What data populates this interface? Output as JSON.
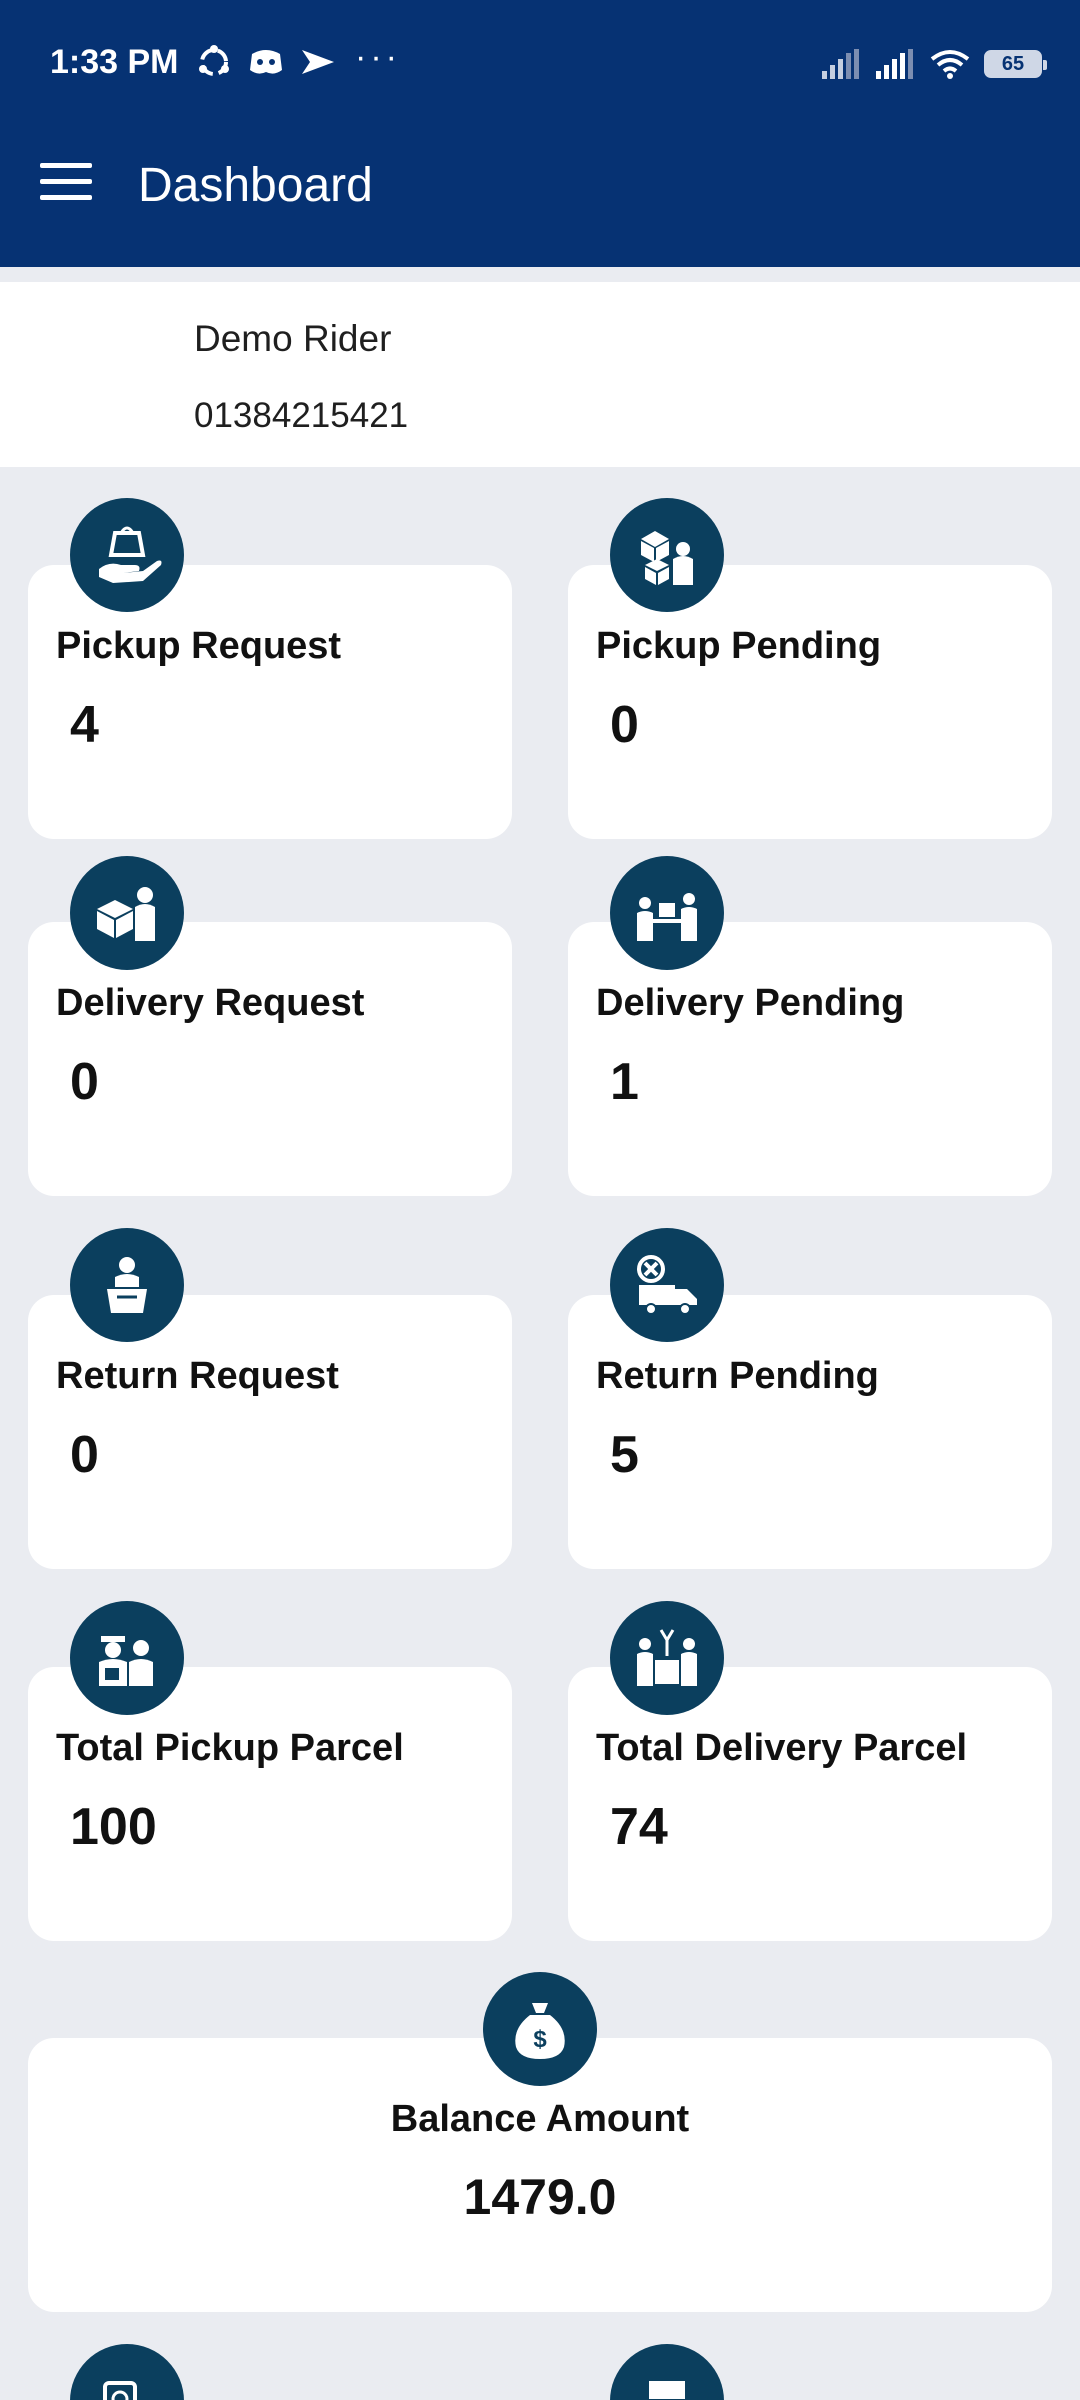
{
  "status_bar": {
    "time": "1:33 PM",
    "notification_icons": [
      "sync-icon",
      "discord-icon",
      "send-icon"
    ],
    "overflow": "···",
    "battery": "65"
  },
  "app_bar": {
    "title": "Dashboard",
    "menu_icon": "hamburger-icon",
    "background": "#063273"
  },
  "profile": {
    "name": "Demo Rider",
    "phone": "01384215421"
  },
  "cards": [
    {
      "label": "Pickup Request",
      "value": "4",
      "icon": "hand-bag-icon"
    },
    {
      "label": "Pickup Pending",
      "value": "0",
      "icon": "boxes-person-icon"
    },
    {
      "label": "Delivery Request",
      "value": "0",
      "icon": "box-person-icon"
    },
    {
      "label": "Delivery Pending",
      "value": "1",
      "icon": "handover-icon"
    },
    {
      "label": "Return Request",
      "value": "0",
      "icon": "person-box-icon"
    },
    {
      "label": "Return Pending",
      "value": "5",
      "icon": "truck-cancel-icon"
    },
    {
      "label": "Total Pickup Parcel",
      "value": "100",
      "icon": "courier-customer-icon"
    },
    {
      "label": "Total Delivery Parcel",
      "value": "74",
      "icon": "delivery-box-icon"
    }
  ],
  "balance": {
    "label": "Balance Amount",
    "value": "1479.0",
    "icon": "money-bag-icon"
  },
  "colors": {
    "accent": "#063273",
    "icon_bg": "#0b3f5e",
    "page_bg": "#eaecf1",
    "card_bg": "#ffffff"
  }
}
